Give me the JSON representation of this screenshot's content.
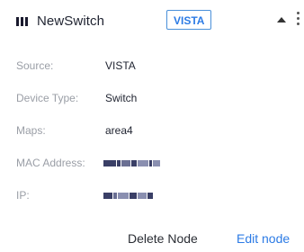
{
  "header": {
    "title": "NewSwitch",
    "badge": "VISTA",
    "device_icon": "switch-icon",
    "collapse_icon": "caret-up-icon",
    "menu_icon": "kebab-menu-icon"
  },
  "details": [
    {
      "label": "Source:",
      "value": "VISTA"
    },
    {
      "label": "Device Type:",
      "value": "Switch"
    },
    {
      "label": "Maps:",
      "value": "area4"
    },
    {
      "label": "MAC Address:",
      "value": ""
    },
    {
      "label": "IP:",
      "value": ""
    }
  ],
  "footer": {
    "delete_label": "Delete Node",
    "edit_label": "Edit node"
  },
  "colors": {
    "accent": "#2c7be5",
    "label": "#9a9ea6",
    "text": "#1f2330"
  }
}
